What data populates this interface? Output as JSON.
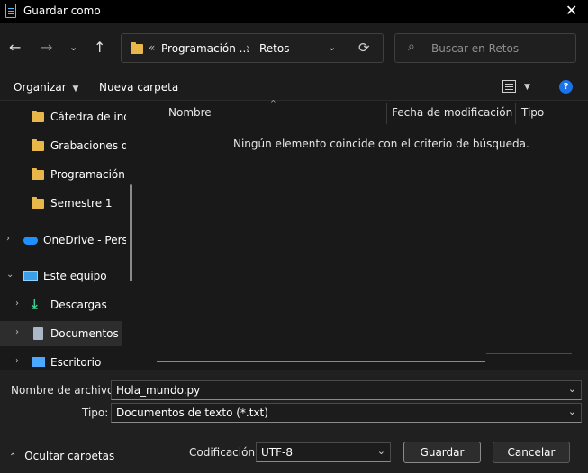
{
  "window": {
    "title": "Guardar como"
  },
  "nav": {
    "address": {
      "prefix": "«",
      "crumb1": "Programación ...",
      "sep": "›",
      "crumb2": "Retos"
    },
    "search_placeholder": "Buscar en Retos"
  },
  "toolbar": {
    "organize": "Organizar",
    "new_folder": "Nueva carpeta"
  },
  "sidebar": {
    "items": [
      {
        "label": "Cátedra de indu"
      },
      {
        "label": "Grabaciones de"
      },
      {
        "label": "Programación d"
      },
      {
        "label": "Semestre 1"
      },
      {
        "label": "OneDrive - Perso"
      },
      {
        "label": "Este equipo"
      },
      {
        "label": "Descargas"
      },
      {
        "label": "Documentos"
      },
      {
        "label": "Escritorio"
      }
    ]
  },
  "file_list": {
    "columns": [
      "Nombre",
      "Fecha de modificación",
      "Tipo"
    ],
    "empty_message": "Ningún elemento coincide con el criterio de búsqueda."
  },
  "form": {
    "filename_label": "Nombre de archivo:",
    "filename_value": "Hola_mundo.py",
    "type_label": "Tipo:",
    "type_value": "Documentos de texto (*.txt)",
    "encoding_label": "Codificación:",
    "encoding_value": "UTF-8"
  },
  "buttons": {
    "hide_folders": "Ocultar carpetas",
    "save": "Guardar",
    "cancel": "Cancelar"
  },
  "colors": {
    "accent": "#4cc2ff",
    "folder": "#e9b64a",
    "help": "#1a73e8"
  }
}
